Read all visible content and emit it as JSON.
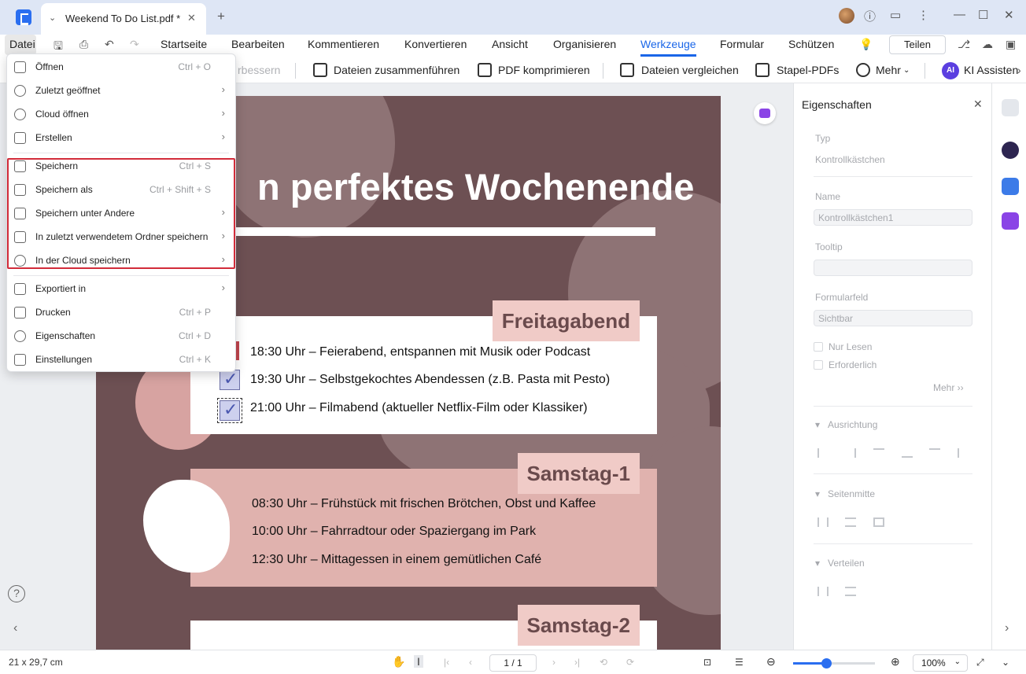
{
  "window": {
    "tab_title": "Weekend To Do List.pdf *"
  },
  "menubar": {
    "file": "Datei",
    "items": [
      "Startseite",
      "Bearbeiten",
      "Kommentieren",
      "Konvertieren",
      "Ansicht",
      "Organisieren",
      "Werkzeuge",
      "Formular",
      "Schützen"
    ],
    "active": "Werkzeuge",
    "share": "Teilen"
  },
  "toolbar": {
    "partial": "rbessern",
    "merge": "Dateien zusammenführen",
    "compress": "PDF komprimieren",
    "compare": "Dateien vergleichen",
    "batch": "Stapel-PDFs",
    "more": "Mehr",
    "ai_badge": "AI",
    "ai": "KI Assisten"
  },
  "file_menu": {
    "items": [
      {
        "label": "Öffnen",
        "shortcut": "Ctrl + O",
        "arrow": ""
      },
      {
        "label": "Zuletzt geöffnet",
        "shortcut": "",
        "arrow": "›"
      },
      {
        "label": "Cloud öffnen",
        "shortcut": "",
        "arrow": "›"
      },
      {
        "label": "Erstellen",
        "shortcut": "",
        "arrow": "›"
      },
      {
        "label": "Speichern",
        "shortcut": "Ctrl + S",
        "arrow": ""
      },
      {
        "label": "Speichern als",
        "shortcut": "Ctrl + Shift + S",
        "arrow": ""
      },
      {
        "label": "Speichern unter Andere",
        "shortcut": "",
        "arrow": "›"
      },
      {
        "label": "In zuletzt verwendetem Ordner speichern",
        "shortcut": "",
        "arrow": "›"
      },
      {
        "label": "In der Cloud speichern",
        "shortcut": "",
        "arrow": "›"
      },
      {
        "label": "Exportiert in",
        "shortcut": "",
        "arrow": "›"
      },
      {
        "label": "Drucken",
        "shortcut": "Ctrl + P",
        "arrow": ""
      },
      {
        "label": "Eigenschaften",
        "shortcut": "Ctrl + D",
        "arrow": ""
      },
      {
        "label": "Einstellungen",
        "shortcut": "Ctrl + K",
        "arrow": ""
      }
    ]
  },
  "document": {
    "title": "n perfektes Wochenende",
    "sections": [
      {
        "heading": "Freitagabend",
        "items": [
          "18:30 Uhr – Feierabend, entspannen mit Musik oder Podcast",
          "19:30 Uhr – Selbstgekochtes Abendessen (z.B. Pasta mit Pesto)",
          "21:00 Uhr – Filmabend (aktueller Netflix-Film oder Klassiker)"
        ]
      },
      {
        "heading": "Samstag-1",
        "items": [
          "08:30 Uhr – Frühstück mit frischen Brötchen, Obst und Kaffee",
          "10:00 Uhr – Fahrradtour oder Spaziergang im Park",
          "12:30 Uhr – Mittagessen in einem gemütlichen Café"
        ]
      },
      {
        "heading": "Samstag-2",
        "items": []
      }
    ]
  },
  "properties": {
    "title": "Eigenschaften",
    "type_label": "Typ",
    "type_value": "Kontrollkästchen",
    "name_label": "Name",
    "name_value": "Kontrollkästchen1",
    "tooltip_label": "Tooltip",
    "tooltip_value": "",
    "field_label": "Formularfeld",
    "field_value": "Sichtbar",
    "readonly": "Nur Lesen",
    "required": "Erforderlich",
    "more": "Mehr ››",
    "align": "Ausrichtung",
    "center": "Seitenmitte",
    "distribute": "Verteilen"
  },
  "status": {
    "page_size": "21 x 29,7 cm",
    "page": "1 / 1",
    "zoom": "100%",
    "zoom_fraction": 0.4
  },
  "colors": {
    "accent": "#1a66e8",
    "page_bg": "#6d5053",
    "highlight": "#d22c3a"
  }
}
